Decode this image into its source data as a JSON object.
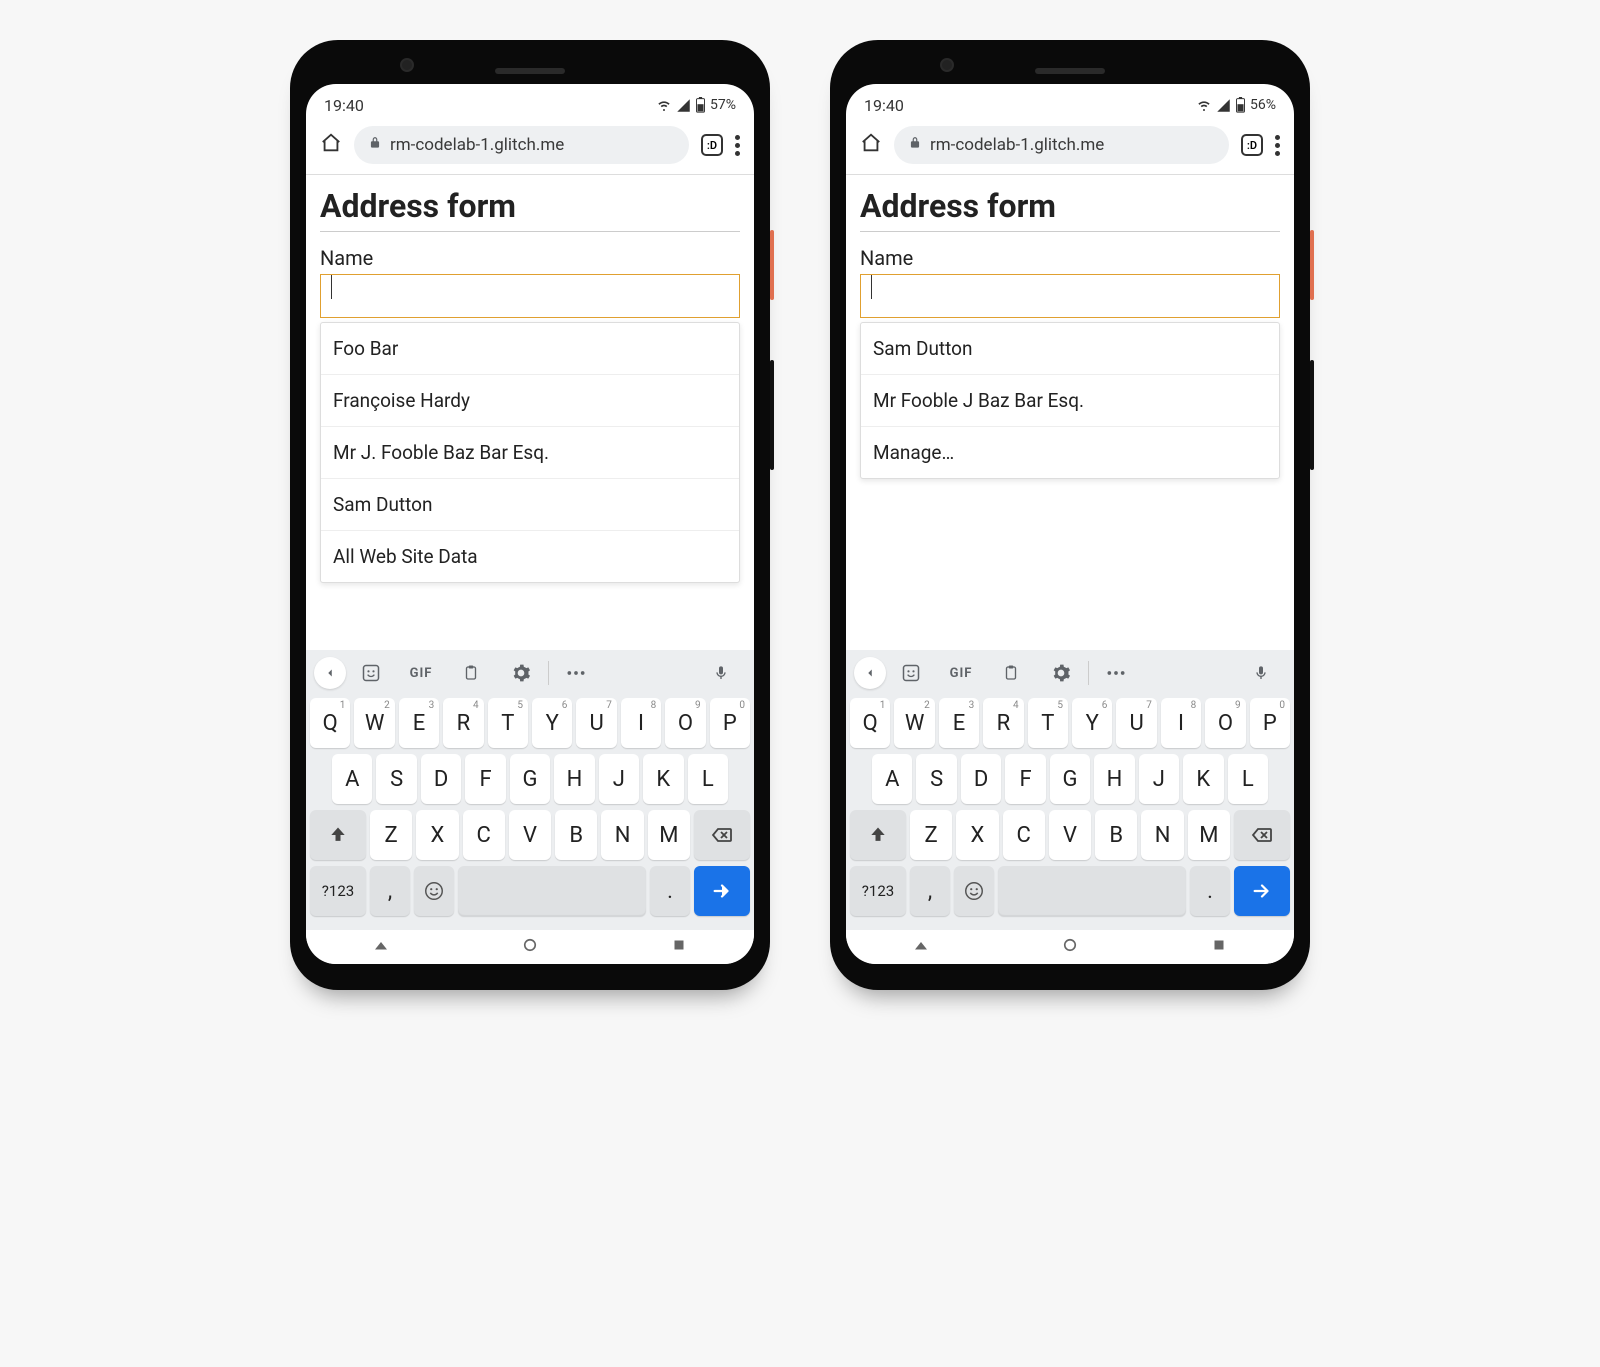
{
  "phones": [
    {
      "status": {
        "time": "19:40",
        "battery": "57%"
      },
      "browser": {
        "url": "rm-codelab-1.glitch.me",
        "tabs_label": ":D"
      },
      "page": {
        "title": "Address form",
        "name_label": "Name",
        "name_value": "",
        "suggestions": [
          "Foo Bar",
          "Françoise Hardy",
          "Mr J. Fooble Baz Bar Esq.",
          "Sam Dutton",
          "All Web Site Data"
        ]
      }
    },
    {
      "status": {
        "time": "19:40",
        "battery": "56%"
      },
      "browser": {
        "url": "rm-codelab-1.glitch.me",
        "tabs_label": ":D"
      },
      "page": {
        "title": "Address form",
        "name_label": "Name",
        "name_value": "",
        "suggestions": [
          "Sam Dutton",
          "Mr Fooble J Baz Bar Esq.",
          "Manage…"
        ]
      }
    }
  ],
  "keyboard": {
    "gif_label": "GIF",
    "row1": [
      {
        "k": "Q",
        "h": "1"
      },
      {
        "k": "W",
        "h": "2"
      },
      {
        "k": "E",
        "h": "3"
      },
      {
        "k": "R",
        "h": "4"
      },
      {
        "k": "T",
        "h": "5"
      },
      {
        "k": "Y",
        "h": "6"
      },
      {
        "k": "U",
        "h": "7"
      },
      {
        "k": "I",
        "h": "8"
      },
      {
        "k": "O",
        "h": "9"
      },
      {
        "k": "P",
        "h": "0"
      }
    ],
    "row2": [
      "A",
      "S",
      "D",
      "F",
      "G",
      "H",
      "J",
      "K",
      "L"
    ],
    "row3": [
      "Z",
      "X",
      "C",
      "V",
      "B",
      "N",
      "M"
    ],
    "symbols_label": "?123",
    "comma_label": ",",
    "period_label": "."
  }
}
